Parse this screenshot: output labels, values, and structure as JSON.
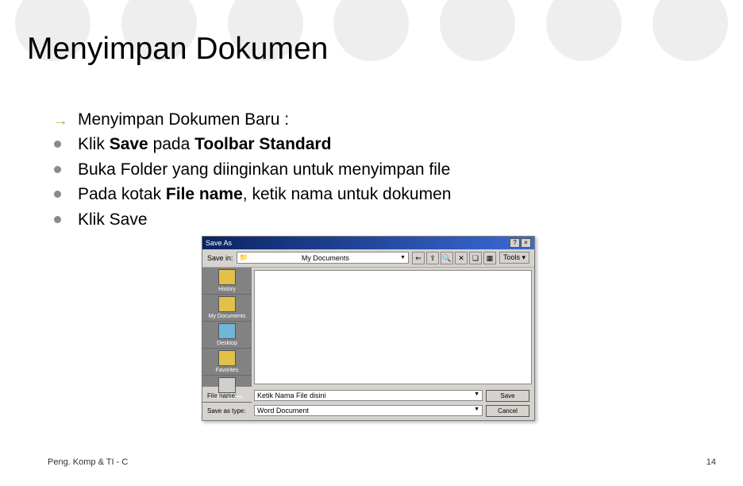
{
  "title": "Menyimpan Dokumen",
  "bullets": {
    "intro": "Menyimpan Dokumen Baru :",
    "b1_pre": "Klik ",
    "b1_bold": "Save",
    "b1_mid": "   pada ",
    "b1_bold2": "Toolbar Standard",
    "b2": "Buka Folder yang diinginkan untuk menyimpan file",
    "b3_pre": "Pada kotak ",
    "b3_bold": "File name",
    "b3_post": ", ketik nama untuk dokumen",
    "b4": "Klik Save"
  },
  "dialog": {
    "title": "Save As",
    "close": "×",
    "help": "?",
    "savein_label": "Save in:",
    "savein_value": "My Documents",
    "tools_label": "Tools ▾",
    "places": {
      "p1": "History",
      "p2": "My Documents",
      "p3": "Desktop",
      "p4": "Favorites",
      "p5": "Web Folders"
    },
    "filename_label": "File name:",
    "filename_value": "Ketik Nama File disini",
    "saveastype_label": "Save as type:",
    "saveastype_value": "Word Document",
    "save_btn": "Save",
    "cancel_btn": "Cancel"
  },
  "footer": {
    "left": "Peng. Komp & TI - C",
    "right": "14"
  }
}
